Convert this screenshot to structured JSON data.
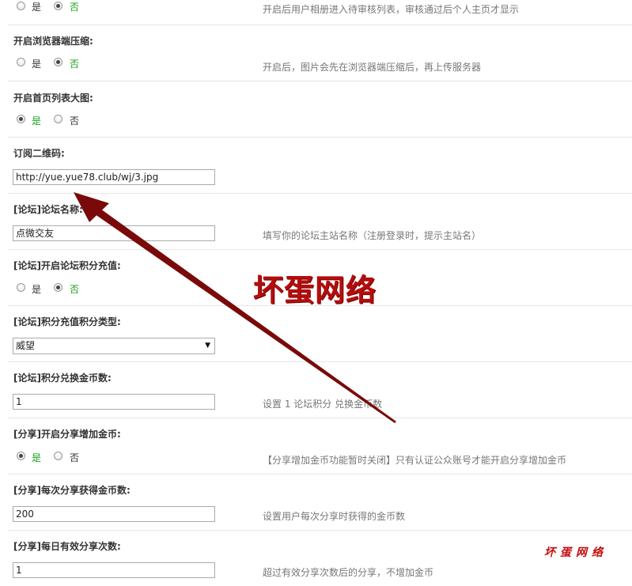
{
  "sections": [
    {
      "title": "",
      "options": [
        {
          "label": "是",
          "checked": false
        },
        {
          "label": "否",
          "checked": true
        }
      ],
      "desc": "开启后用户相册进入待审核列表，审核通过后个人主页才显示"
    },
    {
      "title": "开启浏览器端压缩:",
      "options": [
        {
          "label": "是",
          "checked": false
        },
        {
          "label": "否",
          "checked": true
        }
      ],
      "desc": "开启后，图片会先在浏览器端压缩后，再上传服务器"
    },
    {
      "title": "开启首页列表大图:",
      "options": [
        {
          "label": "是",
          "checked": true
        },
        {
          "label": "否",
          "checked": false
        }
      ],
      "desc": ""
    },
    {
      "title": "订阅二维码:",
      "input": "http://yue.yue78.club/wj/3.jpg",
      "desc": ""
    },
    {
      "title": "[论坛]论坛名称:",
      "input": "点微交友",
      "desc": "填写你的论坛主站名称（注册登录时，提示主站名）"
    },
    {
      "title": "[论坛]开启论坛积分充值:",
      "options": [
        {
          "label": "是",
          "checked": false
        },
        {
          "label": "否",
          "checked": true
        }
      ],
      "desc": ""
    },
    {
      "title": "[论坛]积分充值积分类型:",
      "select": "威望",
      "desc": ""
    },
    {
      "title": "[论坛]积分兑换金币数:",
      "input": "1",
      "desc": "设置 1 论坛积分 兑换金币数"
    },
    {
      "title": "[分享]开启分享增加金币:",
      "options": [
        {
          "label": "是",
          "checked": true
        },
        {
          "label": "否",
          "checked": false
        }
      ],
      "desc": "【分享增加金币功能暂时关闭】只有认证公众账号才能开启分享增加金币"
    },
    {
      "title": "[分享]每次分享获得金币数:",
      "input": "200",
      "desc": "设置用户每次分享时获得的金币数"
    },
    {
      "title": "[分享]每日有效分享次数:",
      "input": "1",
      "desc": "超过有效分享次数后的分享，不增加金币"
    }
  ],
  "watermark": {
    "main": "坏蛋网络",
    "small": "坏蛋网络",
    "color": "#b30d0d"
  },
  "colors": {
    "checked_label": "#1aa31a",
    "arrow": "#7a0a0a"
  }
}
